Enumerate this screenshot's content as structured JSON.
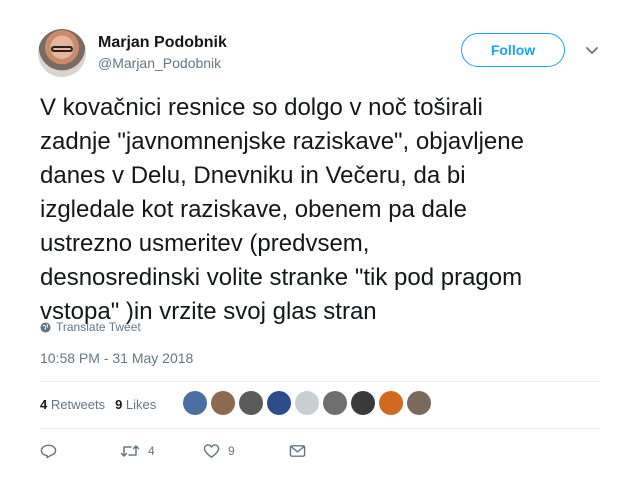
{
  "user": {
    "name": "Marjan Podobnik",
    "handle": "@Marjan_Podobnik"
  },
  "follow_label": "Follow",
  "tweet": {
    "text": "V kovačnici resnice so dolgo v noč  toširali\nzadnje \"javnomnenjske raziskave\", objavljene\ndanes v Delu, Dnevniku in Večeru, da bi\nizgledale kot raziskave, obenem pa dale\nustrezno usmeritev (predvsem,\ndesnosredinski volite stranke \"tik pod pragom\nvstopa\" )in vrzite svoj glas stran",
    "translate_label": "Translate Tweet",
    "timestamp": "10:58 PM - 31 May 2018"
  },
  "stats": {
    "retweets_count": "4",
    "retweets_label": "Retweets",
    "likes_count": "9",
    "likes_label": "Likes"
  },
  "likers": [
    {
      "color": "#4a6fa5"
    },
    {
      "color": "#8c6b4f"
    },
    {
      "color": "#5b5b5b"
    },
    {
      "color": "#2b4d8c"
    },
    {
      "color": "#c9ced3"
    },
    {
      "color": "#6f6f6f"
    },
    {
      "color": "#3a3a3a"
    },
    {
      "color": "#d2691e"
    },
    {
      "color": "#7b6a5c"
    }
  ],
  "actions": {
    "reply_count": "",
    "retweet_count": "4",
    "like_count": "9"
  },
  "colors": {
    "accent": "#1da1f2",
    "secondary_text": "#657786",
    "primary_text": "#14171a",
    "divider": "#e6ecf0"
  },
  "icons": {
    "caret": "chevron-down-icon",
    "translate": "globe-icon",
    "reply": "reply-icon",
    "retweet": "retweet-icon",
    "like": "heart-icon",
    "message": "envelope-icon"
  }
}
